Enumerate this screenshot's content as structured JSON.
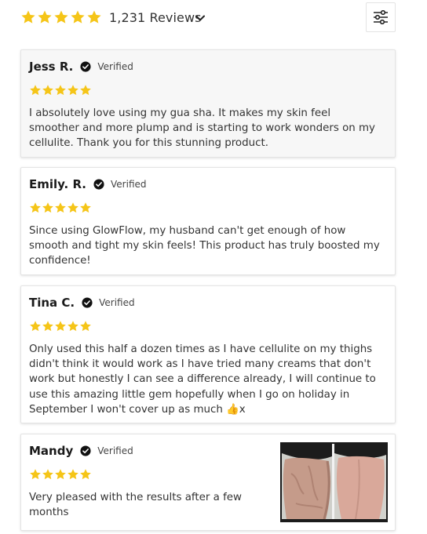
{
  "header": {
    "rating_stars": 5,
    "review_count": "1,231 Reviews",
    "star_color": "#F5C518",
    "icons": {
      "chevron": "chevron-down-icon",
      "filter": "sliders-icon"
    }
  },
  "reviews": [
    {
      "name": "Jess R.",
      "verified_label": "Verified",
      "rating": 5,
      "text": "I absolutely love using my gua sha. It makes my skin feel smoother and more plump and is starting to work wonders on my cellulite. Thank you for this stunning product."
    },
    {
      "name": "Emily. R.",
      "verified_label": "Verified",
      "rating": 5,
      "text": "Since using GlowFlow, my husband can't get enough of how smooth and tight my skin feels! This product has truly boosted my confidence!"
    },
    {
      "name": "Tina C.",
      "verified_label": "Verified",
      "rating": 5,
      "text": "Only used this half a dozen times as I have cellulite on my thighs didn't think it would work as I have tried many creams that don't work but honestly I can see a difference already, I will continue to use this amazing little gem hopefully when I go on holiday in September I won't cover up as much 👍x"
    },
    {
      "name": "Mandy",
      "verified_label": "Verified",
      "rating": 5,
      "text": "Very pleased with the results after a few months",
      "photo": "before-after-photo"
    }
  ]
}
